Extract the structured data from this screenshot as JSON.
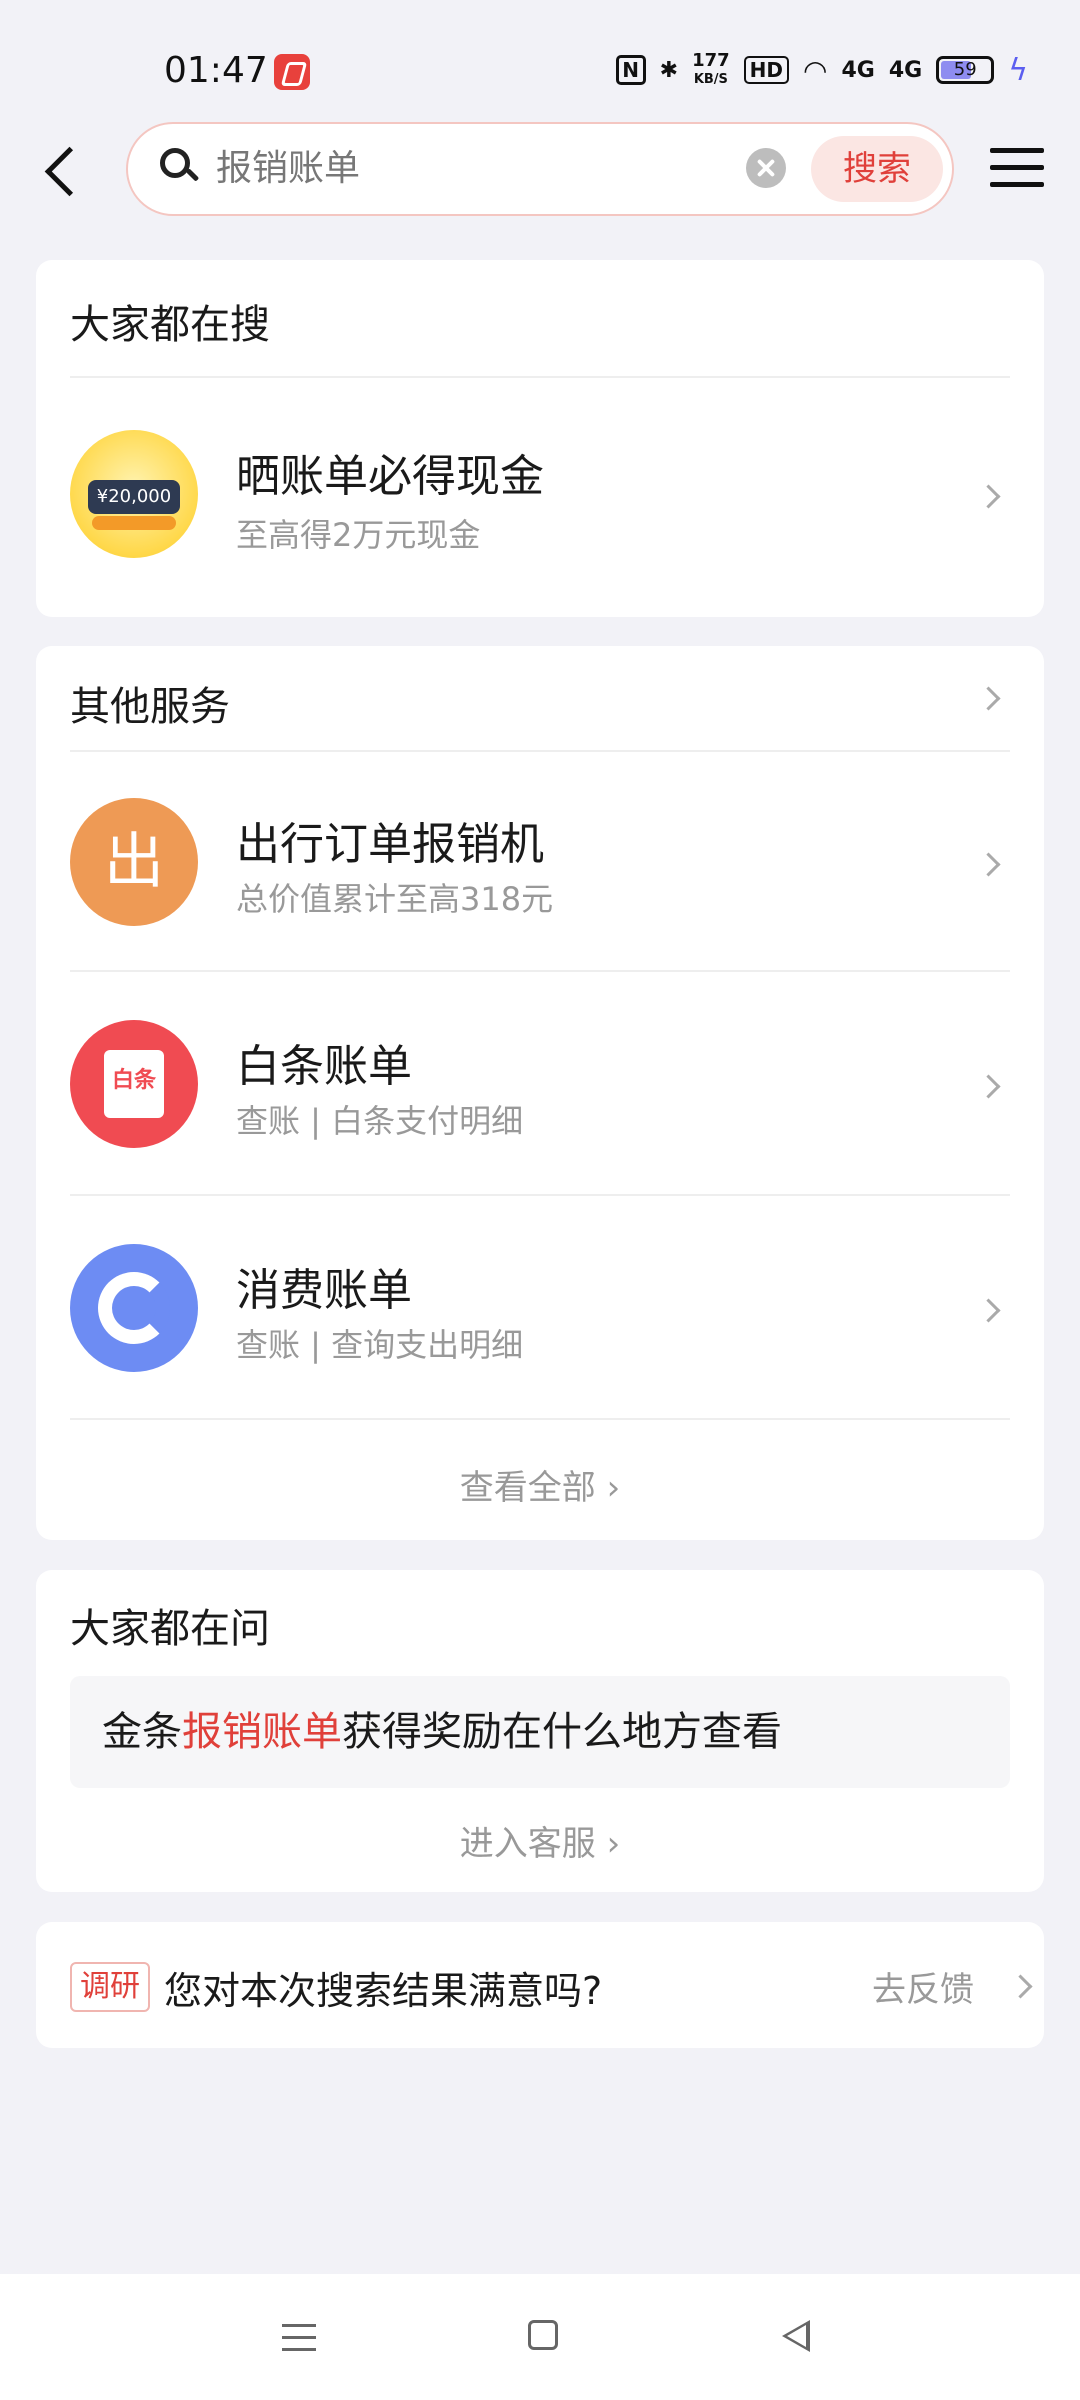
{
  "status_bar": {
    "time": "01:47",
    "network_speed_top": "177",
    "network_speed_unit": "KB/S",
    "hd_label": "HD",
    "signal_1": "4G",
    "signal_2": "4G",
    "battery": "59"
  },
  "header": {
    "search_value": "报销账单",
    "search_button": "搜索"
  },
  "popular": {
    "title": "大家都在搜",
    "item": {
      "title": "晒账单必得现金",
      "subtitle": "至高得2万元现金",
      "icon_amount": "¥20,000"
    }
  },
  "services": {
    "title": "其他服务",
    "items": [
      {
        "title": "出行订单报销机",
        "subtitle": "总价值累计至高318元",
        "icon_text": "出"
      },
      {
        "title": "白条账单",
        "subtitle": "查账 | 白条支付明细",
        "icon_text": "白条"
      },
      {
        "title": "消费账单",
        "subtitle": "查账 | 查询支出明细"
      }
    ],
    "view_all": "查看全部 ›"
  },
  "qa": {
    "title": "大家都在问",
    "question_prefix": "金条",
    "question_highlight": "报销账单",
    "question_suffix": "获得奖励在什么地方查看",
    "enter_service": "进入客服 ›"
  },
  "survey": {
    "tag": "调研",
    "text": "您对本次搜索结果满意吗?",
    "feedback": "去反馈"
  },
  "colors": {
    "accent_red": "#e0403a",
    "background": "#f2f2f7",
    "chu_orange": "#ee9a55",
    "baitiao_red": "#f04b52",
    "xiaofei_blue": "#6d8cf3"
  }
}
